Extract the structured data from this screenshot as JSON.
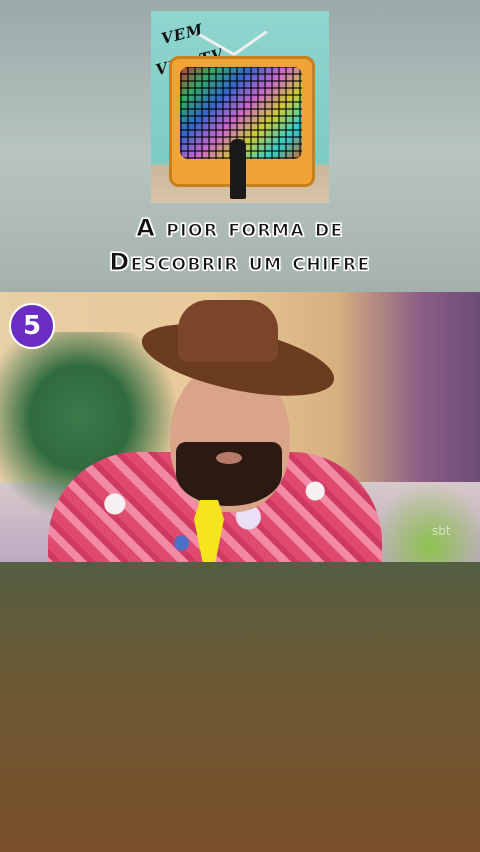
{
  "logo": {
    "line1": "VEM",
    "line2": "VER TV"
  },
  "caption": {
    "line1": "A pior forma de",
    "line2": "Descobrir um chifre"
  },
  "video": {
    "channel_badge": "5",
    "watermark": "sbt"
  },
  "colors": {
    "badge": "#6a2cc2",
    "tie": "#f4e51c",
    "tv": "#f0a435"
  }
}
